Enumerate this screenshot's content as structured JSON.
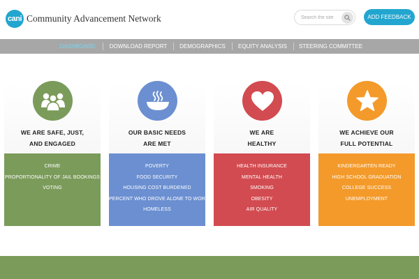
{
  "header": {
    "logo_text": "cani",
    "org_name": "Community Advancement Network",
    "search_placeholder": "Search the site",
    "feedback_label": "ADD FEEDBACK"
  },
  "nav": {
    "items": [
      {
        "label": "DASHBOARD",
        "active": true
      },
      {
        "label": "DOWNLOAD REPORT"
      },
      {
        "label": "DEMOGRAPHICS"
      },
      {
        "label": "EQUITY ANALYSIS"
      },
      {
        "label": "STEERING COMMITTEE"
      }
    ]
  },
  "colors": {
    "accent": "#22a6cf",
    "green": "#7b9b5b",
    "blue": "#6b8fd1",
    "red": "#d24b50",
    "orange": "#f39a2a",
    "nav_bg": "#a7a7a7"
  },
  "cards": [
    {
      "icon": "people-icon",
      "title_line1": "WE ARE SAFE, JUST,",
      "title_line2": "AND ENGAGED",
      "items": [
        "CRIME",
        "PROPORTIONALITY OF JAIL BOOKINGS",
        "VOTING"
      ]
    },
    {
      "icon": "bowl-icon",
      "title_line1": "OUR BASIC NEEDS",
      "title_line2": "ARE MET",
      "items": [
        "POVERTY",
        "FOOD SECURITY",
        "HOUSING COST BURDENED",
        "PERCENT WHO DROVE ALONE TO WORK",
        "HOMELESS"
      ]
    },
    {
      "icon": "heart-icon",
      "title_line1": "WE ARE",
      "title_line2": "HEALTHY",
      "items": [
        "HEALTH INSURANCE",
        "MENTAL HEALTH",
        "SMOKING",
        "OBESITY",
        "AIR QUALITY"
      ]
    },
    {
      "icon": "star-icon",
      "title_line1": "WE ACHIEVE OUR",
      "title_line2": "FULL POTENTIAL",
      "items": [
        "KINDERGARTEN READY",
        "HIGH SCHOOL GRADUATION",
        "COLLEGE SUCCESS",
        "UNEMPLOYMENT"
      ]
    }
  ]
}
